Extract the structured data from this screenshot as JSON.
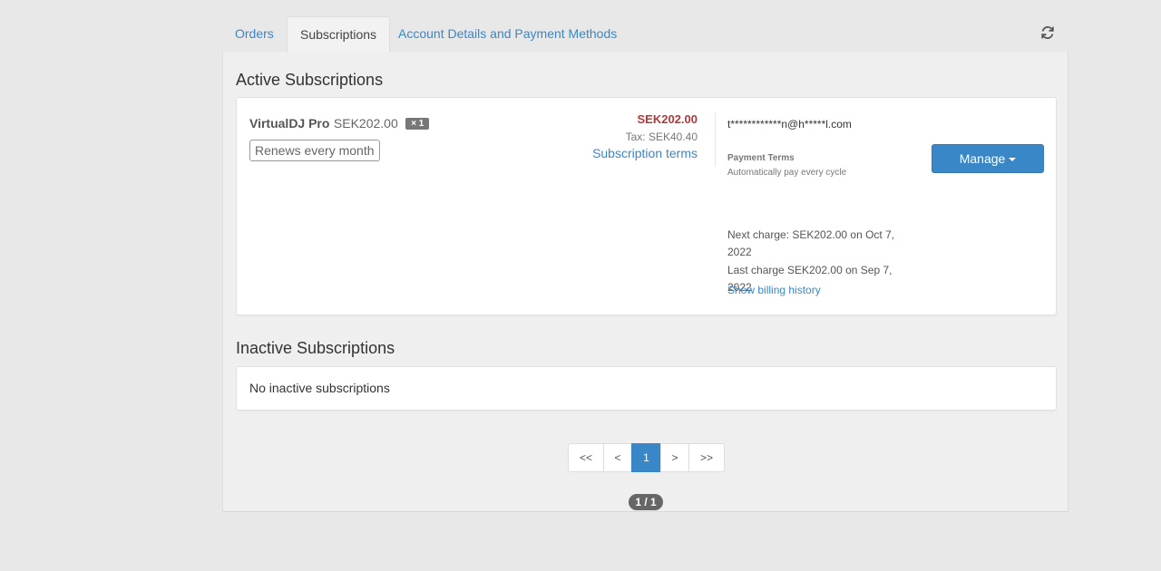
{
  "tabs": [
    {
      "label": "Orders",
      "active": false
    },
    {
      "label": "Subscriptions",
      "active": true
    },
    {
      "label": "Account Details and Payment Methods",
      "active": false
    }
  ],
  "refresh_icon": "refresh-icon",
  "active_section": {
    "title": "Active Subscriptions",
    "subscription": {
      "product_name": "VirtualDJ Pro",
      "product_price": "SEK202.00",
      "quantity_badge": "× 1",
      "renewal_label": "Renews every month",
      "total_price": "SEK202.00",
      "tax": "Tax: SEK40.40",
      "terms_link": "Subscription terms",
      "email": "t************n@h*****l.com",
      "payment_terms_title": "Payment Terms",
      "payment_terms_value": "Automatically pay every cycle",
      "next_charge": "Next charge: SEK202.00 on Oct 7, 2022",
      "last_charge": "Last charge SEK202.00 on Sep 7, 2022",
      "billing_history_link": "Show billing history",
      "manage_button": "Manage"
    }
  },
  "inactive_section": {
    "title": "Inactive Subscriptions",
    "empty_message": "No inactive subscriptions"
  },
  "pagination": {
    "first": "<<",
    "prev": "<",
    "current": "1",
    "next": ">",
    "last": ">>",
    "indicator": "1 / 1"
  },
  "colors": {
    "accent": "#3a87c8",
    "price": "#b0393a",
    "background": "#e8e8e8"
  }
}
